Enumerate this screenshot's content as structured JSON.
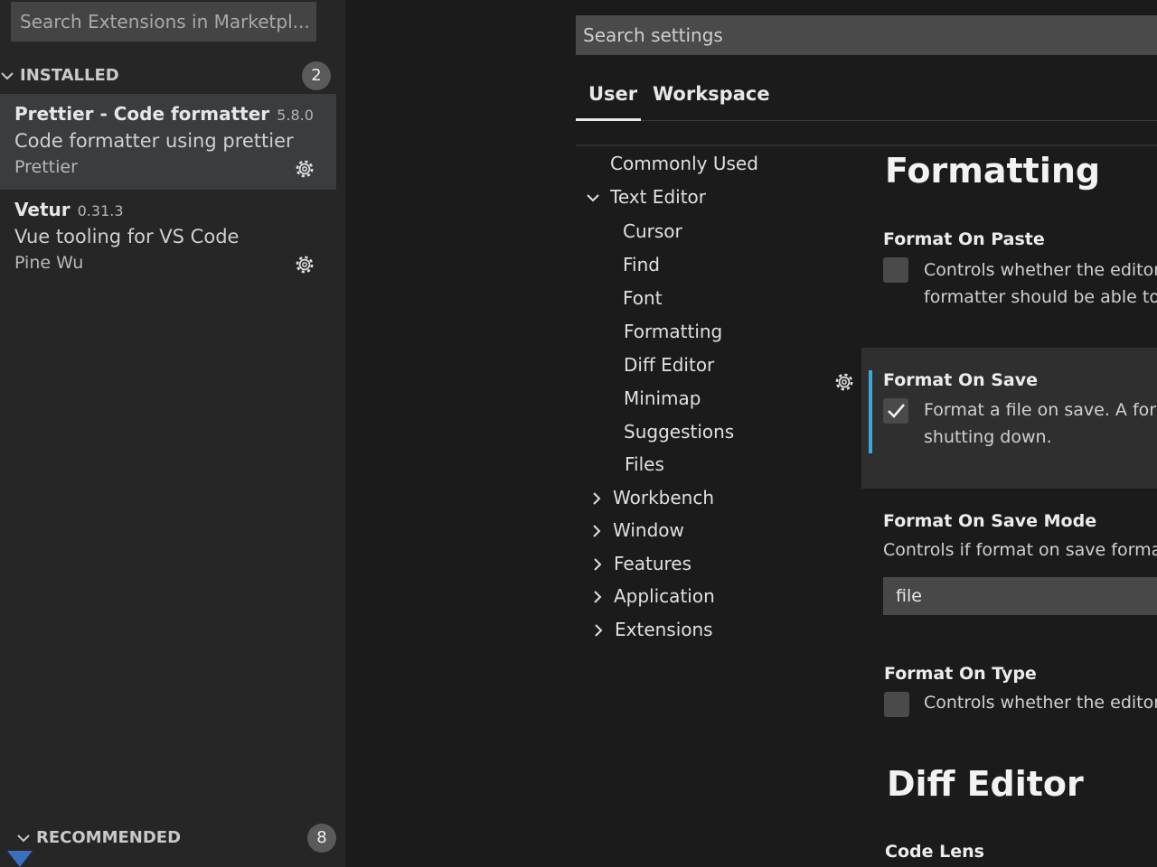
{
  "extensions": {
    "search_placeholder": "Search Extensions in Marketpl...",
    "installed": {
      "label": "INSTALLED",
      "count": "2",
      "items": [
        {
          "name": "Prettier - Code formatter",
          "version": "5.8.0",
          "description": "Code formatter using prettier",
          "author": "Prettier"
        },
        {
          "name": "Vetur",
          "version": "0.31.3",
          "description": "Vue tooling for VS Code",
          "author": "Pine Wu"
        }
      ]
    },
    "recommended": {
      "label": "RECOMMENDED",
      "count": "8"
    }
  },
  "settings": {
    "search_placeholder": "Search settings",
    "tabs": [
      "User",
      "Workspace"
    ],
    "active_tab": "User",
    "toc": [
      {
        "label": "Commonly Used"
      },
      {
        "label": "Text Editor",
        "expanded": true
      },
      {
        "label": "Cursor"
      },
      {
        "label": "Find"
      },
      {
        "label": "Font"
      },
      {
        "label": "Formatting"
      },
      {
        "label": "Diff Editor"
      },
      {
        "label": "Minimap"
      },
      {
        "label": "Suggestions"
      },
      {
        "label": "Files"
      },
      {
        "label": "Workbench",
        "expanded": false
      },
      {
        "label": "Window",
        "expanded": false
      },
      {
        "label": "Features",
        "expanded": false
      },
      {
        "label": "Application",
        "expanded": false
      },
      {
        "label": "Extensions",
        "expanded": false
      }
    ],
    "sections": [
      {
        "title": "Formatting",
        "items": [
          {
            "title": "Format On Paste",
            "desc1": "Controls whether the editor",
            "desc2": "formatter should be able to",
            "checked": false
          },
          {
            "title": "Format On Save",
            "desc1": "Format a file on save. A form",
            "desc2": "shutting down.",
            "checked": true
          },
          {
            "title": "Format On Save Mode",
            "desc1": "Controls if format on save forma",
            "value": "file"
          },
          {
            "title": "Format On Type",
            "desc1": "Controls whether the editor",
            "checked": false
          }
        ]
      },
      {
        "title": "Diff Editor",
        "items": [
          {
            "title": "Code Lens"
          }
        ]
      }
    ],
    "accent_color": "#3ba7dd"
  }
}
